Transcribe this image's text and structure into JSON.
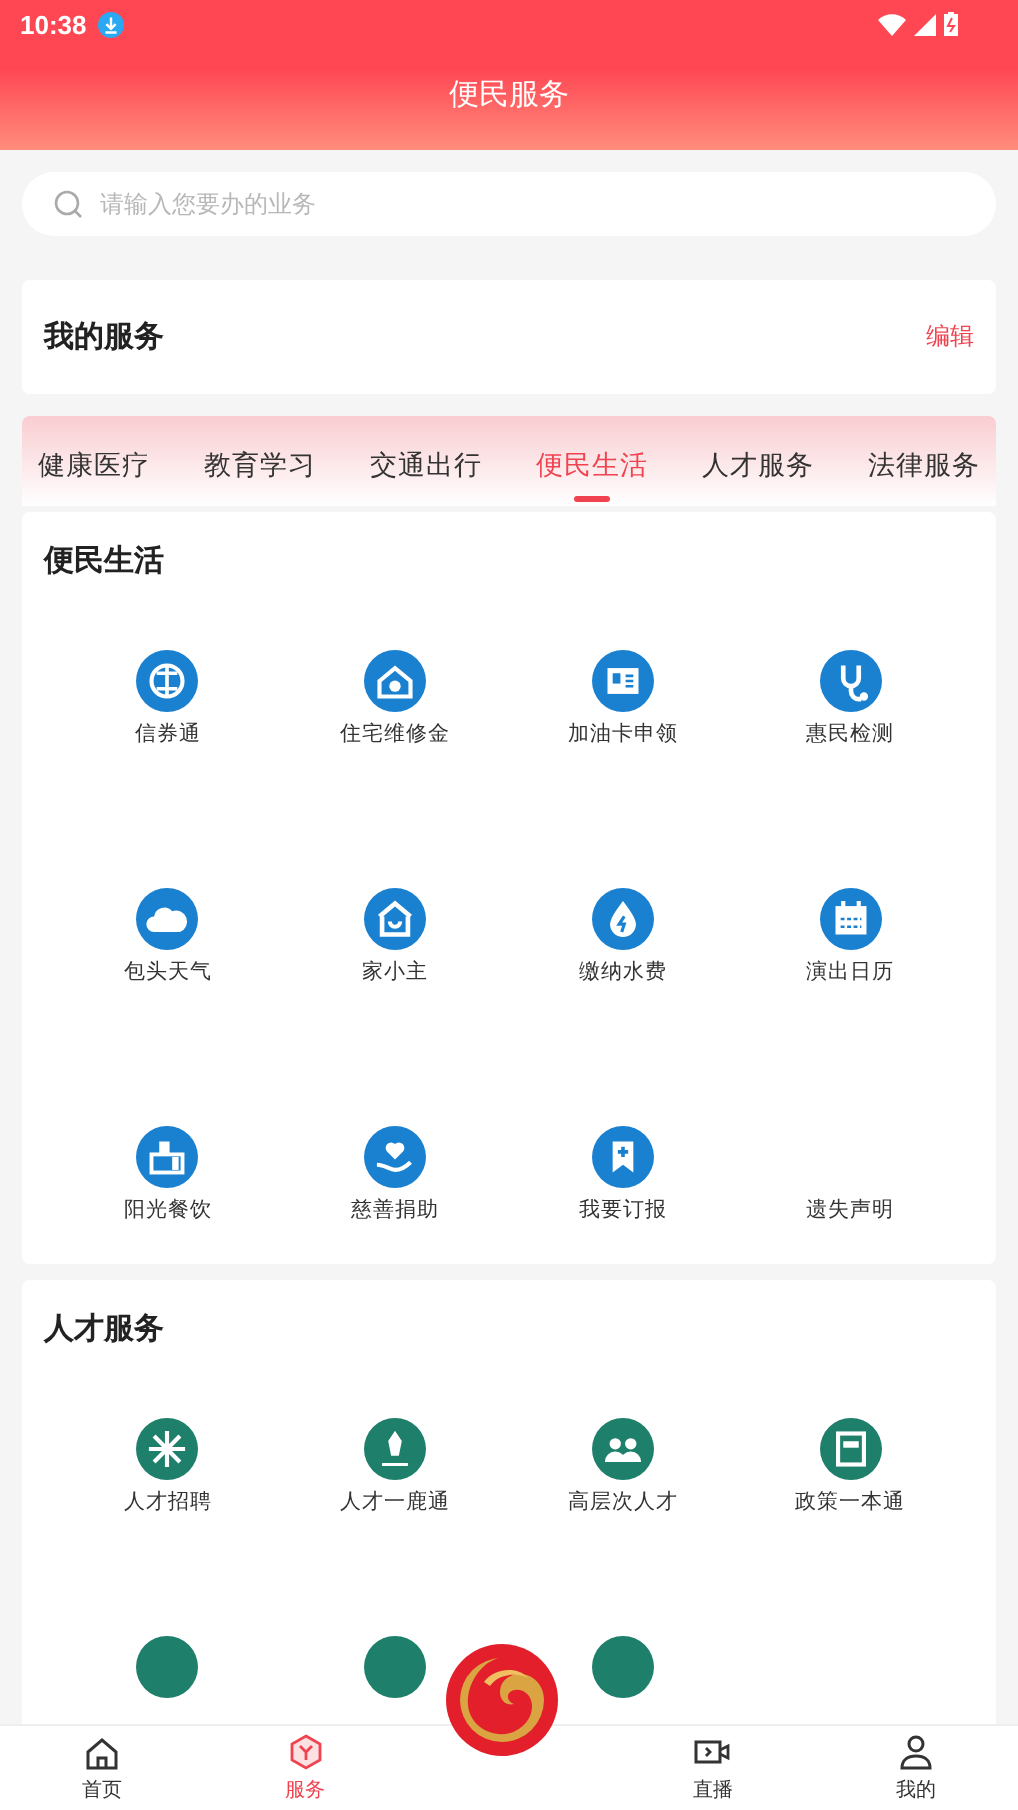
{
  "status_bar": {
    "time": "10:38"
  },
  "header": {
    "title": "便民服务"
  },
  "search": {
    "placeholder": "请输入您要办的业务"
  },
  "my_services": {
    "title": "我的服务",
    "action": "编辑"
  },
  "tabs": [
    {
      "label": "健康医疗",
      "selected": false
    },
    {
      "label": "教育学习",
      "selected": false
    },
    {
      "label": "交通出行",
      "selected": false
    },
    {
      "label": "便民生活",
      "selected": true
    },
    {
      "label": "人才服务",
      "selected": false
    },
    {
      "label": "法律服务",
      "selected": false
    }
  ],
  "sections": [
    {
      "title": "便民生活",
      "color": "#1a80d0",
      "items": [
        {
          "kind": "icon",
          "label": "信券通"
        },
        {
          "kind": "icon",
          "label": "住宅维修金"
        },
        {
          "kind": "icon",
          "label": "加油卡申领"
        },
        {
          "kind": "icon",
          "label": "惠民检测"
        },
        {
          "kind": "icon",
          "label": "包头天气"
        },
        {
          "kind": "icon",
          "label": "家小主"
        },
        {
          "kind": "icon",
          "label": "缴纳水费"
        },
        {
          "kind": "icon",
          "label": "演出日历"
        },
        {
          "kind": "icon",
          "label": "阳光餐饮"
        },
        {
          "kind": "icon",
          "label": "慈善捐助"
        },
        {
          "kind": "icon",
          "label": "我要订报"
        },
        {
          "kind": "text",
          "label": "遗失声明"
        }
      ]
    },
    {
      "title": "人才服务",
      "color": "#1e7f6a",
      "items": [
        {
          "kind": "icon",
          "label": "人才招聘"
        },
        {
          "kind": "icon",
          "label": "人才一鹿通"
        },
        {
          "kind": "icon",
          "label": "高层次人才"
        },
        {
          "kind": "icon",
          "label": "政策一本通"
        },
        {
          "kind": "cut"
        },
        {
          "kind": "cut"
        },
        {
          "kind": "cut"
        }
      ]
    }
  ],
  "nav": [
    {
      "label": "首页",
      "selected": false
    },
    {
      "label": "服务",
      "selected": true
    },
    {
      "kind": "logo"
    },
    {
      "label": "直播",
      "selected": false
    },
    {
      "label": "我的",
      "selected": false
    }
  ]
}
